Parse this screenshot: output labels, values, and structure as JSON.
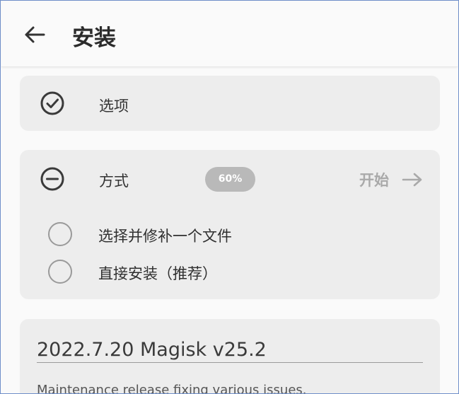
{
  "appbar": {
    "back_icon": "arrow-left-icon",
    "title": "安装"
  },
  "options_card": {
    "icon": "check-circle-icon",
    "label": "选项"
  },
  "method_card": {
    "icon": "minus-circle-icon",
    "label": "方式",
    "progress": "60%",
    "start_label": "开始",
    "start_icon": "arrow-right-icon",
    "choices": [
      {
        "label": "选择并修补一个文件",
        "selected": false
      },
      {
        "label": "直接安装（推荐）",
        "selected": false
      }
    ]
  },
  "release_card": {
    "title": "2022.7.20 Magisk v25.2",
    "description": "Maintenance release fixing various issues."
  }
}
